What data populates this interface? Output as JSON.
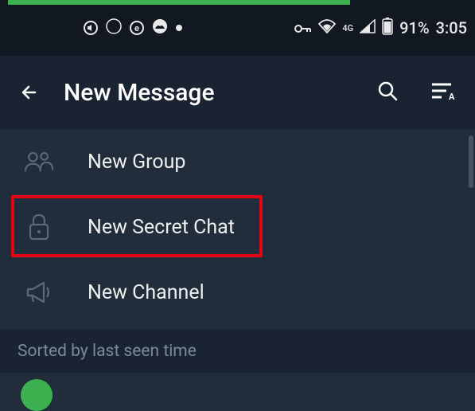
{
  "status_bar": {
    "network_type": "4G",
    "battery_percent": "91%",
    "time": "3:05"
  },
  "app_bar": {
    "title": "New Message"
  },
  "menu": {
    "items": [
      {
        "label": "New Group"
      },
      {
        "label": "New Secret Chat"
      },
      {
        "label": "New Channel"
      }
    ]
  },
  "section": {
    "sorted_label": "Sorted by last seen time"
  }
}
